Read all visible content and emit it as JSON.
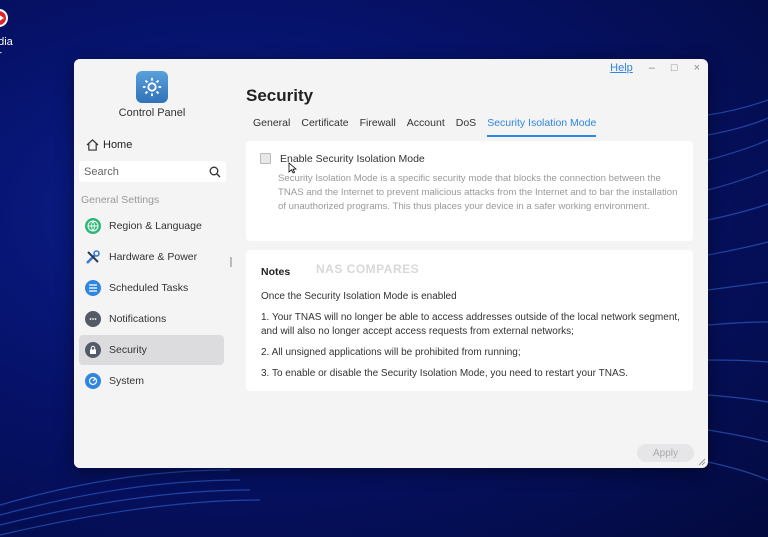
{
  "desktop": {
    "icon_label_line1": "edia",
    "icon_label_line2": "er"
  },
  "window": {
    "app_title": "Control Panel",
    "help": "Help",
    "minimize": "–",
    "maximize": "□",
    "close": "×"
  },
  "sidebar": {
    "home": "Home",
    "search_placeholder": "Search",
    "section_label": "General Settings",
    "items": [
      {
        "label": "Region & Language",
        "icon": "globe-icon",
        "color": "#2bb673"
      },
      {
        "label": "Hardware & Power",
        "icon": "tools-icon",
        "color": "#3a7bd5"
      },
      {
        "label": "Scheduled Tasks",
        "icon": "tasks-icon",
        "color": "#2e86e0"
      },
      {
        "label": "Notifications",
        "icon": "chat-icon",
        "color": "#555b66"
      },
      {
        "label": "Security",
        "icon": "lock-icon",
        "color": "#555b66",
        "active": true
      },
      {
        "label": "System",
        "icon": "gauge-icon",
        "color": "#2e86e0"
      }
    ]
  },
  "main": {
    "page_title": "Security",
    "tabs": [
      "General",
      "Certificate",
      "Firewall",
      "Account",
      "DoS",
      "Security Isolation Mode"
    ],
    "active_tab": "Security Isolation Mode",
    "isolation": {
      "checkbox_label": "Enable Security Isolation Mode",
      "checked": false,
      "description": "Security Isolation Mode is a specific security mode that blocks the connection between the TNAS and the Internet to prevent malicious attacks from the Internet and to bar the installation of unauthorized programs. This thus places your device in a safer working environment."
    },
    "notes": {
      "title": "Notes",
      "watermark": "NAS COMPARES",
      "intro": "Once the Security Isolation Mode is enabled",
      "items": [
        "1. Your TNAS will no longer be able to access addresses outside of the local network segment, and will also no longer accept access requests from external networks;",
        "2. All unsigned applications will be prohibited from running;",
        "3. To enable or disable the Security Isolation Mode, you need to restart your TNAS."
      ]
    },
    "apply": "Apply"
  },
  "colors": {
    "accent": "#2e86e0",
    "desktop_bg": "#06126a"
  }
}
